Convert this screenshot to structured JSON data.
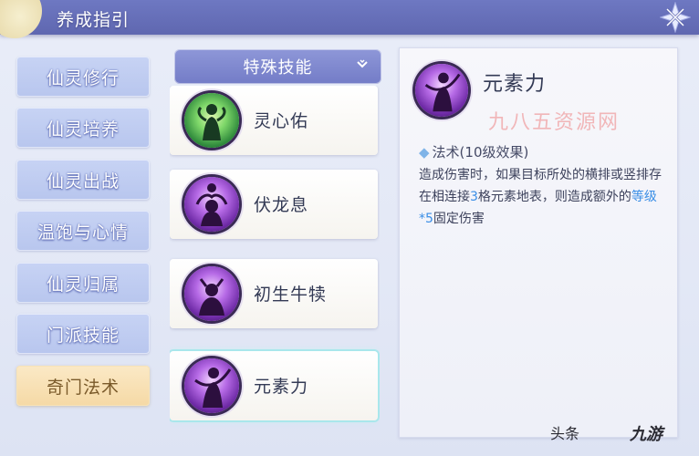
{
  "header": {
    "title": "养成指引"
  },
  "sidebar": {
    "items": [
      {
        "label": "仙灵修行"
      },
      {
        "label": "仙灵培养"
      },
      {
        "label": "仙灵出战"
      },
      {
        "label": "温饱与心情"
      },
      {
        "label": "仙灵归属"
      },
      {
        "label": "门派技能"
      },
      {
        "label": "奇门法术"
      }
    ],
    "active_index": 6
  },
  "skills": {
    "tab_label": "特殊技能",
    "items": [
      {
        "name": "灵心佑",
        "icon": "spirit-heart-icon"
      },
      {
        "name": "伏龙息",
        "icon": "dragon-breath-icon"
      },
      {
        "name": "初生牛犊",
        "icon": "newborn-calf-icon"
      },
      {
        "name": "元素力",
        "icon": "element-power-icon"
      }
    ],
    "selected_index": 3
  },
  "detail": {
    "name": "元素力",
    "watermark": "九八五资源网",
    "effect_title": "法术(10级效果)",
    "desc_part1": "造成伤害时，如果目标所处的横排或竖排存在相连接",
    "desc_hl1": "3",
    "desc_part2": "格元素地表，则造成额外的",
    "desc_hl2": "等级*5",
    "desc_part3": "固定伤害"
  },
  "footer": {
    "text": "头条",
    "logo": "九游"
  },
  "colors": {
    "header": "#6470b9",
    "nav_inactive": "#bfcbf1",
    "nav_active": "#f7dfad",
    "highlight": "#3a8ee6",
    "watermark": "#f1b6b8"
  }
}
